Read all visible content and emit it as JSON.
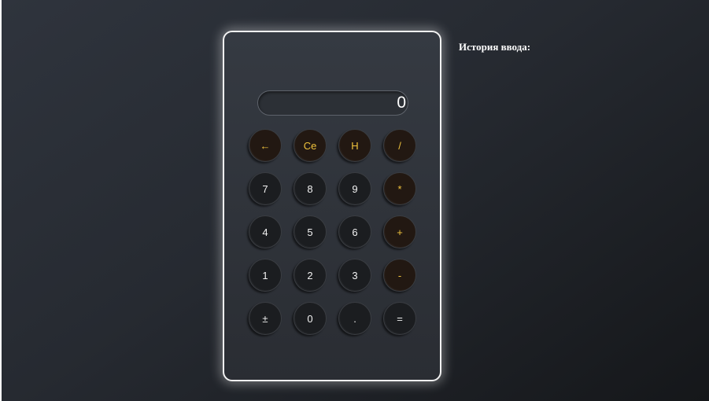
{
  "calculator": {
    "display": "0",
    "keys": [
      {
        "label": "←",
        "name": "backspace-key",
        "kind": "func"
      },
      {
        "label": "Ce",
        "name": "clear-entry-key",
        "kind": "func"
      },
      {
        "label": "H",
        "name": "history-key",
        "kind": "func"
      },
      {
        "label": "/",
        "name": "divide-key",
        "kind": "op"
      },
      {
        "label": "7",
        "name": "digit-7-key",
        "kind": "num"
      },
      {
        "label": "8",
        "name": "digit-8-key",
        "kind": "num"
      },
      {
        "label": "9",
        "name": "digit-9-key",
        "kind": "num"
      },
      {
        "label": "*",
        "name": "multiply-key",
        "kind": "op"
      },
      {
        "label": "4",
        "name": "digit-4-key",
        "kind": "num"
      },
      {
        "label": "5",
        "name": "digit-5-key",
        "kind": "num"
      },
      {
        "label": "6",
        "name": "digit-6-key",
        "kind": "num"
      },
      {
        "label": "+",
        "name": "add-key",
        "kind": "op"
      },
      {
        "label": "1",
        "name": "digit-1-key",
        "kind": "num"
      },
      {
        "label": "2",
        "name": "digit-2-key",
        "kind": "num"
      },
      {
        "label": "3",
        "name": "digit-3-key",
        "kind": "num"
      },
      {
        "label": "-",
        "name": "subtract-key",
        "kind": "op"
      },
      {
        "label": "±",
        "name": "sign-toggle-key",
        "kind": "num"
      },
      {
        "label": "0",
        "name": "digit-0-key",
        "kind": "num"
      },
      {
        "label": ".",
        "name": "decimal-key",
        "kind": "num"
      },
      {
        "label": "=",
        "name": "equals-key",
        "kind": "eq"
      }
    ]
  },
  "history": {
    "title": "История ввода:"
  },
  "colors": {
    "accent": "#f0c33c",
    "key_background": "#1b1d20",
    "operator_background": "#221812",
    "frame_border": "#f2f2f2"
  }
}
